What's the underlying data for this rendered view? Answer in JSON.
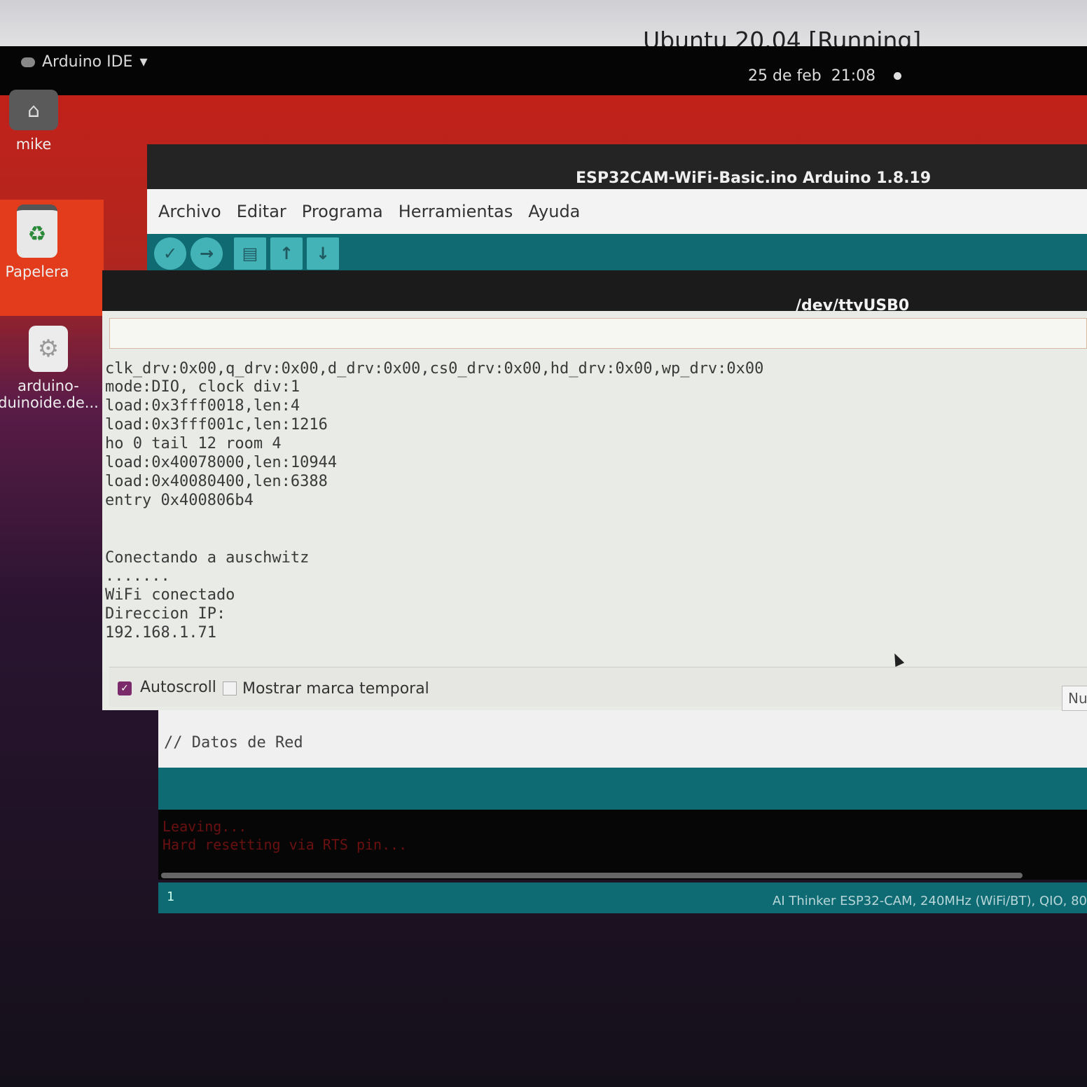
{
  "vm_window": {
    "title": "Ubuntu 20.04 [Running]"
  },
  "top_bar": {
    "app_menu": "Arduino IDE",
    "date": "25 de feb",
    "time": "21:08"
  },
  "desktop": {
    "icons": [
      {
        "label": "mike",
        "icon": "home-icon"
      },
      {
        "label": "Papelera",
        "icon": "trash-icon"
      },
      {
        "label_line1": "arduino-",
        "label_line2": "duinoide.de...",
        "icon": "gear-icon"
      }
    ]
  },
  "ide": {
    "title": "ESP32CAM-WiFi-Basic.ino Arduino 1.8.19",
    "menu": [
      "Archivo",
      "Editar",
      "Programa",
      "Herramientas",
      "Ayuda"
    ],
    "toolbar": [
      "verify-icon",
      "upload-icon",
      "new-icon",
      "open-icon",
      "save-icon"
    ],
    "code_line": "// Datos de Red",
    "console_lines": [
      "Leaving...",
      "Hard resetting via RTS pin..."
    ],
    "line_number": "1",
    "board_info": "AI Thinker ESP32-CAM, 240MHz (WiFi/BT), QIO, 80"
  },
  "serial_monitor": {
    "title": "/dev/ttyUSB0",
    "input_value": "",
    "output": [
      "clk_drv:0x00,q_drv:0x00,d_drv:0x00,cs0_drv:0x00,hd_drv:0x00,wp_drv:0x00",
      "mode:DIO, clock div:1",
      "load:0x3fff0018,len:4",
      "load:0x3fff001c,len:1216",
      "ho 0 tail 12 room 4",
      "load:0x40078000,len:10944",
      "load:0x40080400,len:6388",
      "entry 0x400806b4",
      "",
      "",
      "Conectando a auschwitz",
      ".......",
      "WiFi conectado",
      "Direccion IP:",
      "192.168.1.71"
    ],
    "autoscroll_label": "Autoscroll",
    "autoscroll_checked": true,
    "timestamp_label": "Mostrar marca temporal",
    "timestamp_checked": false,
    "line_ending": "Nu"
  }
}
